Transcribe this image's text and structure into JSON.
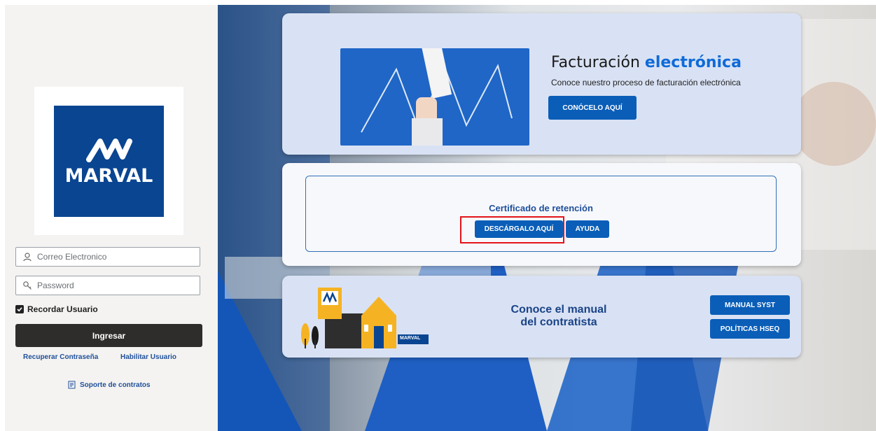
{
  "brand": {
    "logo_text": "MARVAL",
    "color_primary": "#0a4591",
    "color_button": "#0a5eb8",
    "color_highlight": "#e3141b"
  },
  "login": {
    "email_placeholder": "Correo Electronico",
    "password_placeholder": "Password",
    "remember_label": "Recordar Usuario",
    "remember_checked": true,
    "submit_label": "Ingresar",
    "recover_link": "Recuperar Contraseña",
    "enable_link": "Habilitar Usuario",
    "support_link": "Soporte de contratos",
    "icons": {
      "user": "user-icon",
      "password": "key-icon",
      "support": "document-icon"
    }
  },
  "cards": {
    "facturacion": {
      "title_plain": "Facturación ",
      "title_bold": "electrónica",
      "subtitle": "Conoce nuestro proceso de facturación electrónica",
      "button": "CONÓCELO AQUÍ"
    },
    "certificado": {
      "title": "Certificado de retención",
      "download_button": "DESCÁRGALO AQUÍ",
      "help_button": "AYUDA"
    },
    "manual": {
      "title_line1": "Conoce el manual",
      "title_line2": "del contratista",
      "button_manual": "MANUAL SYST",
      "button_hseq": "POLÍTICAS HSEQ",
      "illustration_sign": "MARVAL"
    }
  }
}
